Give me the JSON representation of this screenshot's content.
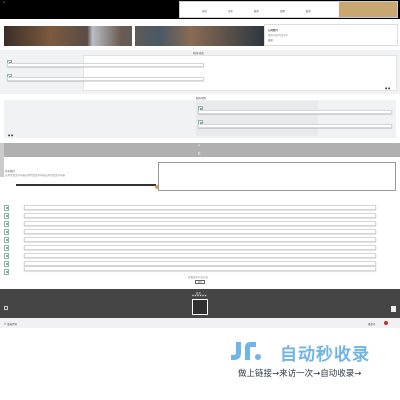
{
  "header": {
    "logo_text": "≡",
    "nav_items": [
      "首页",
      "关于",
      "服务",
      "案例",
      "联系"
    ],
    "cta_label": ""
  },
  "banner": {
    "side_title": "公司简介",
    "side_text": "服务内容介绍文字",
    "side_link": "更多"
  },
  "section1": {
    "title": "新闻·动态",
    "pager": "● ●"
  },
  "section2": {
    "title": "服务项目",
    "pager": "● ●"
  },
  "grey_strip": {
    "icon_label": "◎",
    "text": "联"
  },
  "section3": {
    "title": "关于我们",
    "text": "公司介绍文字内容公司介绍文字内容公司介绍文字内容"
  },
  "list": {
    "title": "产品列表",
    "row_count_label": "",
    "more_text": "查看更多产品信息",
    "more_button": "更多"
  },
  "footer": {
    "title": "联系",
    "sub": "▣ ▣ ▣ ▣ ▣ ▣"
  },
  "bottom_bar": {
    "left_text": "© 版权所有",
    "right_text": "备案号"
  },
  "watermark": {
    "brand": "自动秒收录",
    "slogan": "做上链接→来访一次→自动收录→",
    "brand_color": "#6fb5e6",
    "text_color": "#2f3a4a"
  }
}
